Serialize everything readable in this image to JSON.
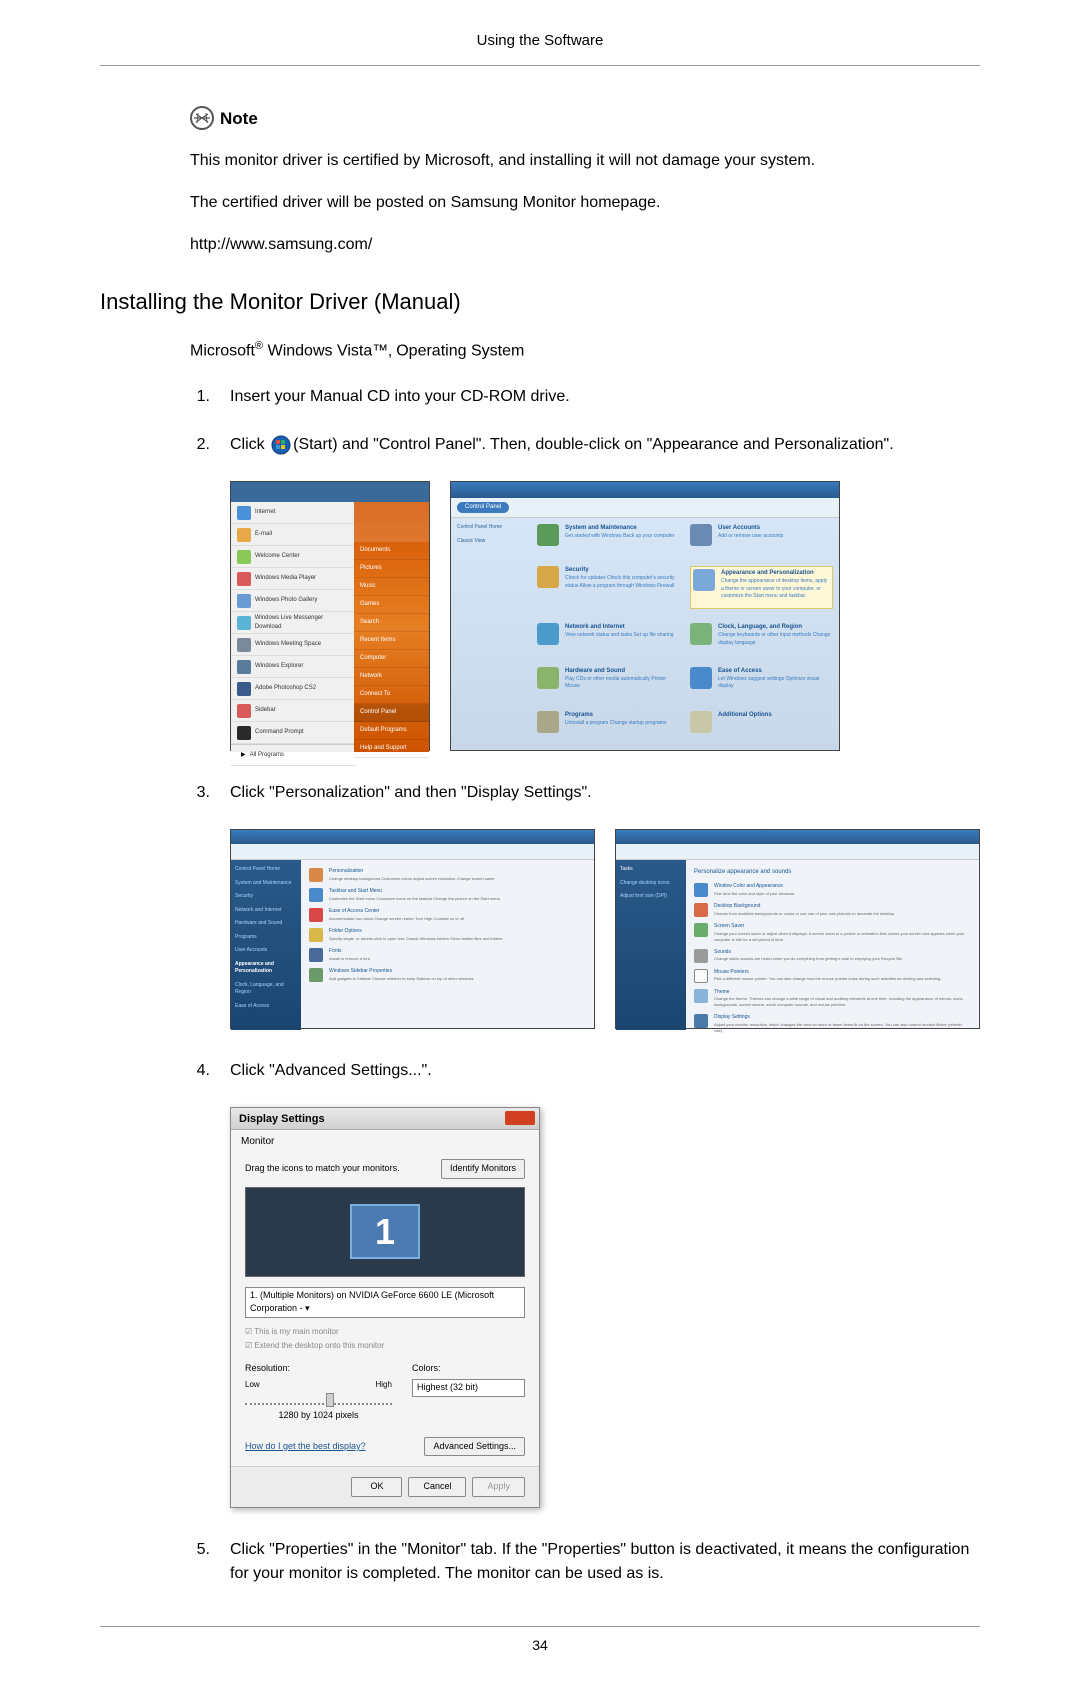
{
  "header": {
    "title": "Using the Software"
  },
  "note": {
    "label": "Note",
    "line1": "This monitor driver is certified by Microsoft, and installing it will not damage your system.",
    "line2": "The certified driver will be posted on Samsung Monitor homepage.",
    "url": "http://www.samsung.com/"
  },
  "heading": "Installing the Monitor Driver (Manual)",
  "os_prefix": "Microsoft",
  "os_reg": "®",
  "os_suffix": " Windows Vista™‚ Operating System",
  "steps": {
    "s1": {
      "num": "1.",
      "text": "Insert your Manual CD into your CD-ROM drive."
    },
    "s2": {
      "num": "2.",
      "pre": "Click ",
      "post": "(Start) and \"Control Panel\". Then, double-click on \"Appearance and Personalization\"."
    },
    "s3": {
      "num": "3.",
      "text": "Click \"Personalization\" and then \"Display Settings\"."
    },
    "s4": {
      "num": "4.",
      "text": "Click \"Advanced Settings...\"."
    },
    "s5": {
      "num": "5.",
      "text": "Click \"Properties\" in the \"Monitor\" tab. If the \"Properties\" button is deactivated, it means the configuration for your monitor is completed. The monitor can be used as is."
    }
  },
  "start_menu": {
    "items": [
      "Internet",
      "E-mail",
      "Welcome Center",
      "Windows Media Player",
      "Windows Photo Gallery",
      "Windows Live Messenger Download",
      "Windows Meeting Space",
      "Windows Explorer",
      "Adobe Photoshop CS2",
      "Sidebar",
      "Command Prompt"
    ],
    "all_programs": "All Programs",
    "right_items": [
      "Documents",
      "Pictures",
      "Music",
      "Games",
      "Search",
      "Recent Items",
      "Computer",
      "Network",
      "Connect To",
      "Control Panel",
      "Default Programs",
      "Help and Support"
    ]
  },
  "control_panel": {
    "title": "Control Panel",
    "sidebar_title": "Control Panel Home",
    "sidebar_classic": "Classic View",
    "categories": [
      {
        "title": "System and Maintenance",
        "sub": "Get started with Windows\nBack up your computer"
      },
      {
        "title": "User Accounts",
        "sub": "Add or remove user accounts"
      },
      {
        "title": "Security",
        "sub": "Check for updates\nCheck this computer's security status\nAllow a program through Windows Firewall"
      },
      {
        "title": "Appearance and Personalization",
        "sub": "Change the appearance of desktop items, apply a theme or screen saver to your computer, or customize the Start menu and taskbar."
      },
      {
        "title": "Network and Internet",
        "sub": "View network status and tasks\nSet up file sharing"
      },
      {
        "title": "Clock, Language, and Region",
        "sub": "Change keyboards or other input methods\nChange display language"
      },
      {
        "title": "Hardware and Sound",
        "sub": "Play CDs or other media automatically\nPrinter\nMouse"
      },
      {
        "title": "Ease of Access",
        "sub": "Let Windows suggest settings\nOptimize visual display"
      },
      {
        "title": "Programs",
        "sub": "Uninstall a program\nChange startup programs"
      },
      {
        "title": "Additional Options",
        "sub": ""
      }
    ]
  },
  "appearance_panel": {
    "sidebar": [
      "Control Panel Home",
      "System and Maintenance",
      "Security",
      "Network and Internet",
      "Hardware and Sound",
      "Programs",
      "User Accounts",
      "Appearance and Personalization",
      "Clock, Language, and Region",
      "Ease of Access"
    ],
    "items": [
      {
        "title": "Personalization",
        "sub": "Change desktop background  Customize colors  Adjust screen resolution  Change screen saver"
      },
      {
        "title": "Taskbar and Start Menu",
        "sub": "Customize the Start menu  Customize icons on the taskbar  Change the picture on the Start menu"
      },
      {
        "title": "Ease of Access Center",
        "sub": "Accommodate low vision  Change screen reader  Turn High Contrast on or off"
      },
      {
        "title": "Folder Options",
        "sub": "Specify single- or double-click to open  Use Classic Windows folders  Show hidden files and folders"
      },
      {
        "title": "Fonts",
        "sub": "Install or remove a font"
      },
      {
        "title": "Windows Sidebar Properties",
        "sub": "Add gadgets to Sidebar  Choose whether to keep Sidebar on top of other windows"
      }
    ]
  },
  "personalization": {
    "sidebar": [
      "Tasks",
      "Change desktop icons",
      "Adjust font size (DPI)"
    ],
    "heading": "Personalize appearance and sounds",
    "items": [
      {
        "title": "Window Color and Appearance",
        "sub": "Fine tune the color and style of your windows."
      },
      {
        "title": "Desktop Background",
        "sub": "Choose from available backgrounds or colors or use one of your own pictures to decorate the desktop."
      },
      {
        "title": "Screen Saver",
        "sub": "Change your screen saver or adjust when it displays. A screen saver is a picture or animation that covers your screen and appears when your computer is idle for a set period of time."
      },
      {
        "title": "Sounds",
        "sub": "Change which sounds are heard when you do everything from getting e-mail to emptying your Recycle Bin."
      },
      {
        "title": "Mouse Pointers",
        "sub": "Pick a different mouse pointer. You can also change how the mouse pointer looks during such activities as clicking and selecting."
      },
      {
        "title": "Theme",
        "sub": "Change the theme. Themes can change a wide range of visual and auditory elements at one time, including the appearance of menus, icons, backgrounds, screen savers, some computer sounds, and mouse pointers."
      },
      {
        "title": "Display Settings",
        "sub": "Adjust your monitor resolution, which changes the view so more or fewer items fit on the screen. You can also control monitor flicker (refresh rate)."
      }
    ]
  },
  "display_settings": {
    "title": "Display Settings",
    "tab": "Monitor",
    "drag_text": "Drag the icons to match your monitors.",
    "identify": "Identify Monitors",
    "monitor_num": "1",
    "monitor_select": "1. (Multiple Monitors) on NVIDIA GeForce 6600 LE (Microsoft Corporation - ▾",
    "check1": "This is my main monitor",
    "check2": "Extend the desktop onto this monitor",
    "resolution_label": "Resolution:",
    "low": "Low",
    "high": "High",
    "res_value": "1280 by 1024 pixels",
    "colors_label": "Colors:",
    "colors_value": "Highest (32 bit)",
    "help_link": "How do I get the best display?",
    "advanced": "Advanced Settings...",
    "ok": "OK",
    "cancel": "Cancel",
    "apply": "Apply"
  },
  "page_number": "34"
}
